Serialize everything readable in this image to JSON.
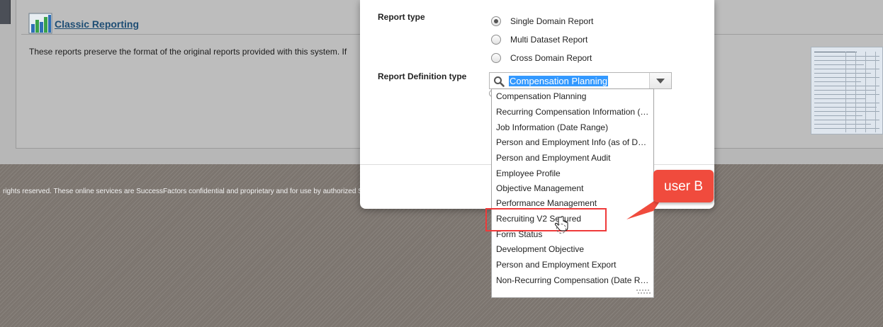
{
  "background": {
    "classic_reporting_title": "Classic Reporting",
    "classic_reporting_description": "These reports preserve the format of the original reports provided with this system. If",
    "footer_text": "rights reserved. These online services are SuccessFactors confidential and proprietary and for use by authorized S"
  },
  "dialog": {
    "report_type_label": "Report type",
    "report_types": [
      {
        "label": "Single Domain Report",
        "selected": true
      },
      {
        "label": "Multi Dataset Report",
        "selected": false
      },
      {
        "label": "Cross Domain Report",
        "selected": false
      }
    ],
    "report_definition_label": "Report Definition type",
    "combo_value": "Compensation Planning",
    "options": [
      "Compensation Planning",
      "Recurring Compensation Information (…",
      "Job Information (Date Range)",
      "Person and Employment Info (as of Date)",
      "Person and Employment Audit",
      "Employee Profile",
      "Objective Management",
      "Performance Management",
      "Recruiting V2 Secured",
      "Form Status",
      "Development Objective",
      "Person and Employment Export",
      "Non-Recurring Compensation (Date R…"
    ]
  },
  "annotation": {
    "callout_label": "user B",
    "color": "#f04b3d"
  },
  "colors": {
    "link": "#1e4d74",
    "selection": "#3399ff"
  }
}
